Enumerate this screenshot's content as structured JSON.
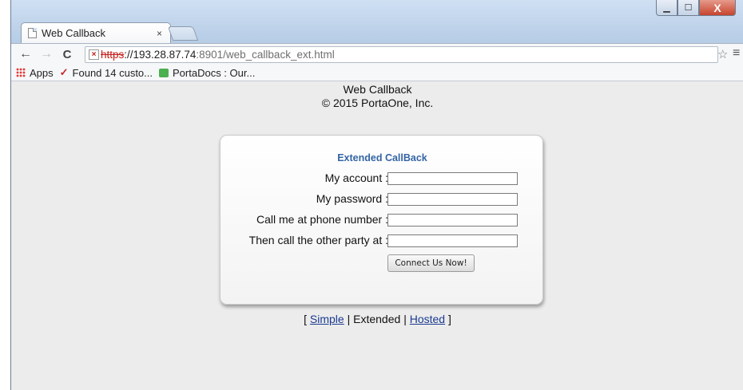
{
  "browser": {
    "tab_title": "Web Callback",
    "tab_close": "×",
    "window_buttons": {
      "minimize": "▁",
      "maximize": "☐",
      "close": "X"
    },
    "nav": {
      "back": "←",
      "forward": "→",
      "reload": "C"
    },
    "url": {
      "scheme": "https",
      "host": "://193.28.87.74",
      "rest": ":8901/web_callback_ext.html"
    },
    "icons": {
      "star": "star-icon",
      "menu": "menu-icon"
    },
    "bookmarks": [
      {
        "label": "Apps",
        "icon": "apps-icon"
      },
      {
        "label": "Found 14 custo...",
        "icon": "check-icon"
      },
      {
        "label": "PortaDocs : Our...",
        "icon": "portadocs-icon"
      }
    ]
  },
  "page": {
    "title": "Web Callback",
    "copyright": "© 2015 PortaOne, Inc.",
    "form": {
      "heading": "Extended CallBack",
      "fields": [
        {
          "label": "My account :",
          "value": ""
        },
        {
          "label": "My password :",
          "value": ""
        },
        {
          "label": "Call me at phone number :",
          "value": ""
        },
        {
          "label": "Then call the other party at :",
          "value": ""
        }
      ],
      "submit_label": "Connect Us Now!"
    },
    "modes": {
      "open": "[",
      "simple": "Simple",
      "sep1": "|",
      "extended": "Extended",
      "sep2": "|",
      "hosted": "Hosted",
      "close": "]"
    }
  }
}
